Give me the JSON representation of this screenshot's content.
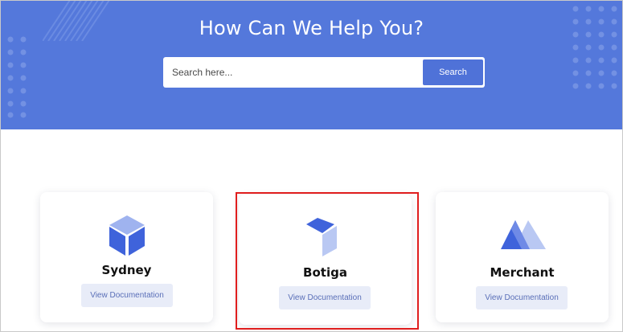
{
  "hero": {
    "title": "How Can We Help You?",
    "background_color": "#5478db"
  },
  "search": {
    "placeholder": "Search here...",
    "button_label": "Search"
  },
  "cards": [
    {
      "title": "Sydney",
      "button_label": "View Documentation",
      "icon": "cube-icon"
    },
    {
      "title": "Botiga",
      "button_label": "View Documentation",
      "icon": "box-icon"
    },
    {
      "title": "Merchant",
      "button_label": "View Documentation",
      "icon": "mountain-icon"
    }
  ],
  "colors": {
    "accent": "#4f72d8",
    "highlight": "#e01e1e",
    "button_bg": "#e8ecf8",
    "button_text": "#5a6fb8"
  }
}
